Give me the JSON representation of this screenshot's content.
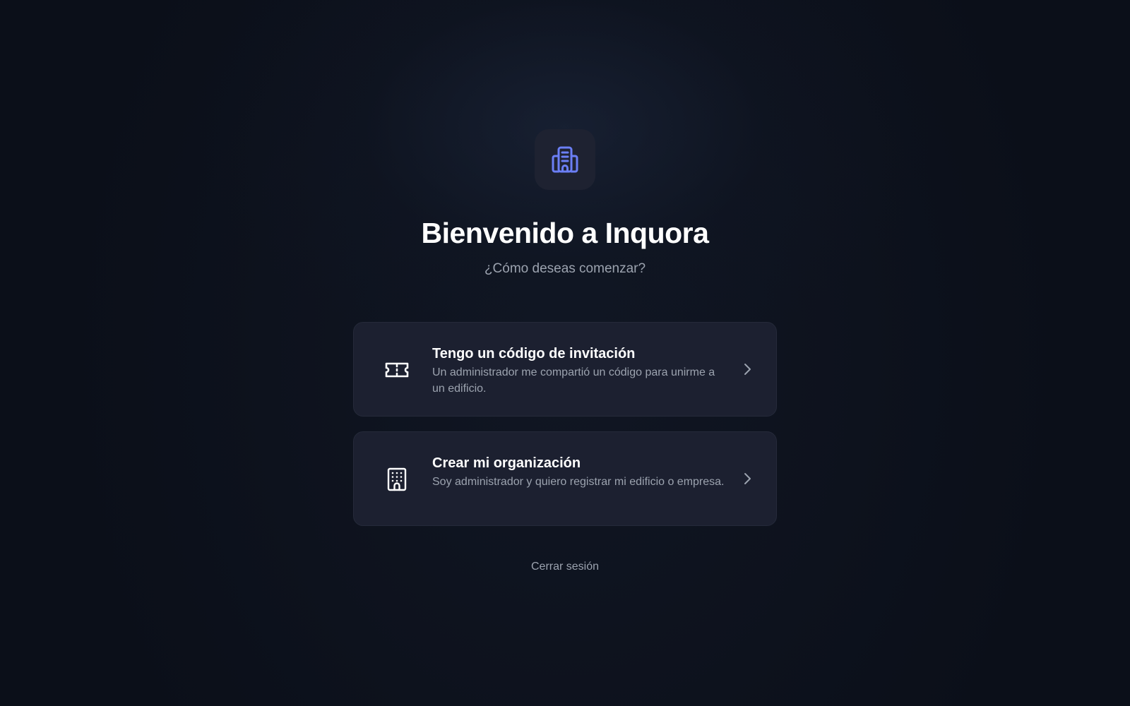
{
  "brand": {
    "logo_icon": "building-office-icon",
    "accent_color": "#6b7ff5"
  },
  "header": {
    "title": "Bienvenido a Inquora",
    "subtitle": "¿Cómo deseas comenzar?"
  },
  "options": [
    {
      "icon": "ticket-icon",
      "title": "Tengo un código de invitación",
      "description": "Un administrador me compartió un código para unirme a un edificio."
    },
    {
      "icon": "building-icon",
      "title": "Crear mi organización",
      "description": "Soy administrador y quiero registrar mi edificio o empresa."
    }
  ],
  "footer": {
    "logout_label": "Cerrar sesión"
  }
}
